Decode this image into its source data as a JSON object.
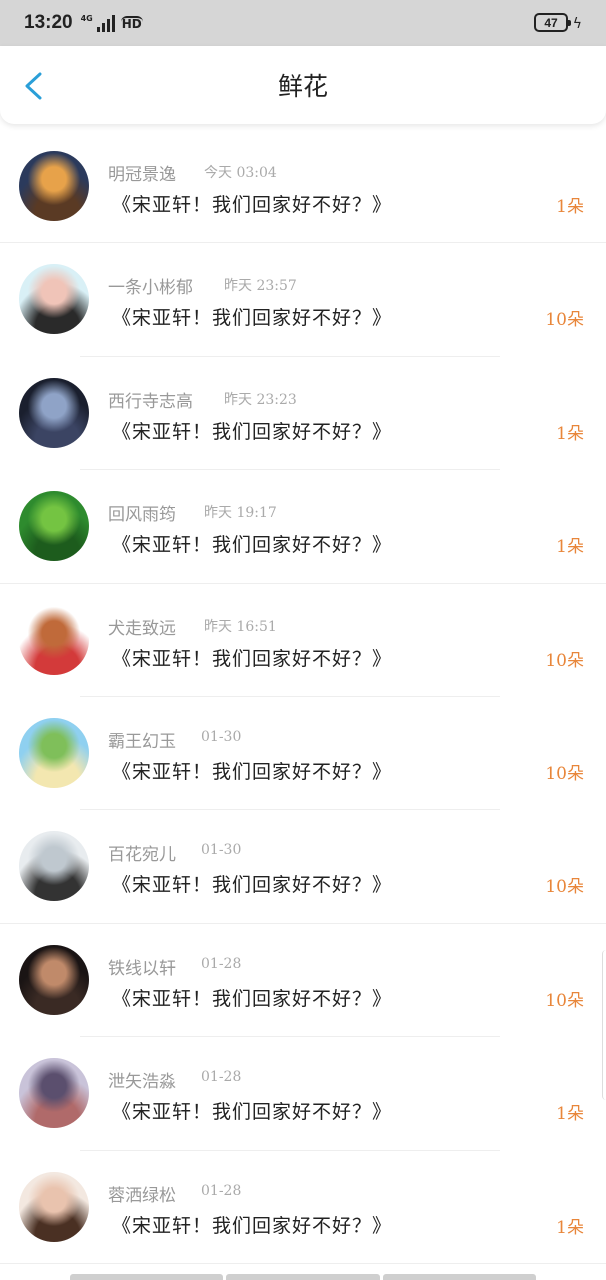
{
  "status_bar": {
    "time": "13:20",
    "network": "4G",
    "hd": "HD",
    "battery": "47"
  },
  "header": {
    "title": "鲜花"
  },
  "message": "《宋亚轩！我们回家好不好？》",
  "items": [
    {
      "name": "明冠景逸",
      "time": "今天 03:04",
      "count": "1朵",
      "avatar_colors": [
        "#2b3a5c",
        "#e7a24a",
        "#5a3a24"
      ]
    },
    {
      "name": "一条小彬郁",
      "time": "昨天 23:57",
      "count": "10朵",
      "avatar_colors": [
        "#d9f0f6",
        "#f0c4b8",
        "#2a2a2a"
      ]
    },
    {
      "name": "西行寺志高",
      "time": "昨天 23:23",
      "count": "1朵",
      "avatar_colors": [
        "#1a1f2e",
        "#8fa3c7",
        "#3b4463"
      ]
    },
    {
      "name": "回风雨筠",
      "time": "昨天 19:17",
      "count": "1朵",
      "avatar_colors": [
        "#2e8b2e",
        "#74c442",
        "#1d5c1d"
      ]
    },
    {
      "name": "犬走致远",
      "time": "昨天 16:51",
      "count": "10朵",
      "avatar_colors": [
        "#ffffff",
        "#c06a3a",
        "#d33a3a"
      ]
    },
    {
      "name": "霸王幻玉",
      "time": "01-30",
      "count": "10朵",
      "avatar_colors": [
        "#8fd0f0",
        "#7fbf5a",
        "#f3e7b0"
      ]
    },
    {
      "name": "百花宛儿",
      "time": "01-30",
      "count": "10朵",
      "avatar_colors": [
        "#e8ecef",
        "#bfc8cf",
        "#333333"
      ]
    },
    {
      "name": "铁线以轩",
      "time": "01-28",
      "count": "10朵",
      "avatar_colors": [
        "#1a1414",
        "#c08a6a",
        "#3a2a24"
      ]
    },
    {
      "name": "泄矢浩淼",
      "time": "01-28",
      "count": "1朵",
      "avatar_colors": [
        "#c9c3d9",
        "#5b4f6e",
        "#b06a6a"
      ]
    },
    {
      "name": "蓉洒绿松",
      "time": "01-28",
      "count": "1朵",
      "avatar_colors": [
        "#f3e8e0",
        "#e9c3ae",
        "#4a3023"
      ]
    }
  ]
}
